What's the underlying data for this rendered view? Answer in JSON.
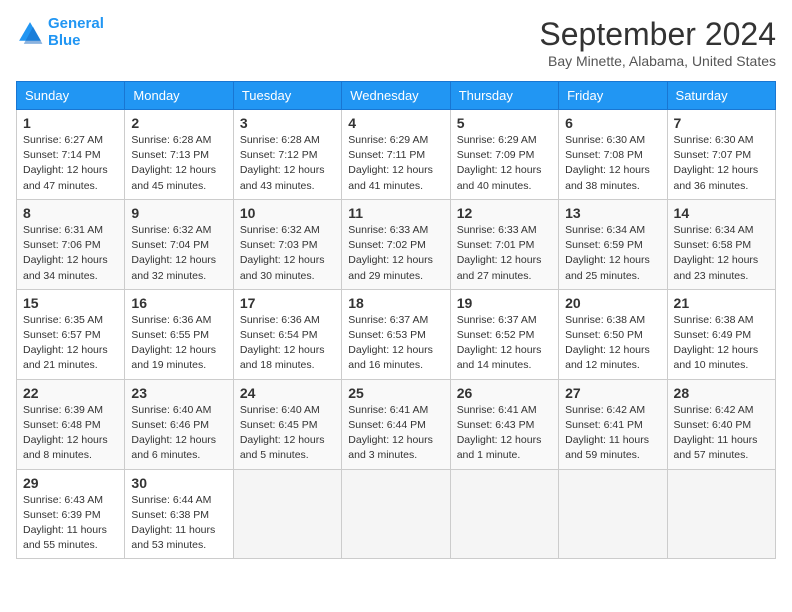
{
  "header": {
    "logo_line1": "General",
    "logo_line2": "Blue",
    "month_title": "September 2024",
    "location": "Bay Minette, Alabama, United States"
  },
  "weekdays": [
    "Sunday",
    "Monday",
    "Tuesday",
    "Wednesday",
    "Thursday",
    "Friday",
    "Saturday"
  ],
  "weeks": [
    [
      {
        "day": "1",
        "info": "Sunrise: 6:27 AM\nSunset: 7:14 PM\nDaylight: 12 hours\nand 47 minutes."
      },
      {
        "day": "2",
        "info": "Sunrise: 6:28 AM\nSunset: 7:13 PM\nDaylight: 12 hours\nand 45 minutes."
      },
      {
        "day": "3",
        "info": "Sunrise: 6:28 AM\nSunset: 7:12 PM\nDaylight: 12 hours\nand 43 minutes."
      },
      {
        "day": "4",
        "info": "Sunrise: 6:29 AM\nSunset: 7:11 PM\nDaylight: 12 hours\nand 41 minutes."
      },
      {
        "day": "5",
        "info": "Sunrise: 6:29 AM\nSunset: 7:09 PM\nDaylight: 12 hours\nand 40 minutes."
      },
      {
        "day": "6",
        "info": "Sunrise: 6:30 AM\nSunset: 7:08 PM\nDaylight: 12 hours\nand 38 minutes."
      },
      {
        "day": "7",
        "info": "Sunrise: 6:30 AM\nSunset: 7:07 PM\nDaylight: 12 hours\nand 36 minutes."
      }
    ],
    [
      {
        "day": "8",
        "info": "Sunrise: 6:31 AM\nSunset: 7:06 PM\nDaylight: 12 hours\nand 34 minutes."
      },
      {
        "day": "9",
        "info": "Sunrise: 6:32 AM\nSunset: 7:04 PM\nDaylight: 12 hours\nand 32 minutes."
      },
      {
        "day": "10",
        "info": "Sunrise: 6:32 AM\nSunset: 7:03 PM\nDaylight: 12 hours\nand 30 minutes."
      },
      {
        "day": "11",
        "info": "Sunrise: 6:33 AM\nSunset: 7:02 PM\nDaylight: 12 hours\nand 29 minutes."
      },
      {
        "day": "12",
        "info": "Sunrise: 6:33 AM\nSunset: 7:01 PM\nDaylight: 12 hours\nand 27 minutes."
      },
      {
        "day": "13",
        "info": "Sunrise: 6:34 AM\nSunset: 6:59 PM\nDaylight: 12 hours\nand 25 minutes."
      },
      {
        "day": "14",
        "info": "Sunrise: 6:34 AM\nSunset: 6:58 PM\nDaylight: 12 hours\nand 23 minutes."
      }
    ],
    [
      {
        "day": "15",
        "info": "Sunrise: 6:35 AM\nSunset: 6:57 PM\nDaylight: 12 hours\nand 21 minutes."
      },
      {
        "day": "16",
        "info": "Sunrise: 6:36 AM\nSunset: 6:55 PM\nDaylight: 12 hours\nand 19 minutes."
      },
      {
        "day": "17",
        "info": "Sunrise: 6:36 AM\nSunset: 6:54 PM\nDaylight: 12 hours\nand 18 minutes."
      },
      {
        "day": "18",
        "info": "Sunrise: 6:37 AM\nSunset: 6:53 PM\nDaylight: 12 hours\nand 16 minutes."
      },
      {
        "day": "19",
        "info": "Sunrise: 6:37 AM\nSunset: 6:52 PM\nDaylight: 12 hours\nand 14 minutes."
      },
      {
        "day": "20",
        "info": "Sunrise: 6:38 AM\nSunset: 6:50 PM\nDaylight: 12 hours\nand 12 minutes."
      },
      {
        "day": "21",
        "info": "Sunrise: 6:38 AM\nSunset: 6:49 PM\nDaylight: 12 hours\nand 10 minutes."
      }
    ],
    [
      {
        "day": "22",
        "info": "Sunrise: 6:39 AM\nSunset: 6:48 PM\nDaylight: 12 hours\nand 8 minutes."
      },
      {
        "day": "23",
        "info": "Sunrise: 6:40 AM\nSunset: 6:46 PM\nDaylight: 12 hours\nand 6 minutes."
      },
      {
        "day": "24",
        "info": "Sunrise: 6:40 AM\nSunset: 6:45 PM\nDaylight: 12 hours\nand 5 minutes."
      },
      {
        "day": "25",
        "info": "Sunrise: 6:41 AM\nSunset: 6:44 PM\nDaylight: 12 hours\nand 3 minutes."
      },
      {
        "day": "26",
        "info": "Sunrise: 6:41 AM\nSunset: 6:43 PM\nDaylight: 12 hours\nand 1 minute."
      },
      {
        "day": "27",
        "info": "Sunrise: 6:42 AM\nSunset: 6:41 PM\nDaylight: 11 hours\nand 59 minutes."
      },
      {
        "day": "28",
        "info": "Sunrise: 6:42 AM\nSunset: 6:40 PM\nDaylight: 11 hours\nand 57 minutes."
      }
    ],
    [
      {
        "day": "29",
        "info": "Sunrise: 6:43 AM\nSunset: 6:39 PM\nDaylight: 11 hours\nand 55 minutes."
      },
      {
        "day": "30",
        "info": "Sunrise: 6:44 AM\nSunset: 6:38 PM\nDaylight: 11 hours\nand 53 minutes."
      },
      {
        "day": "",
        "info": ""
      },
      {
        "day": "",
        "info": ""
      },
      {
        "day": "",
        "info": ""
      },
      {
        "day": "",
        "info": ""
      },
      {
        "day": "",
        "info": ""
      }
    ]
  ]
}
